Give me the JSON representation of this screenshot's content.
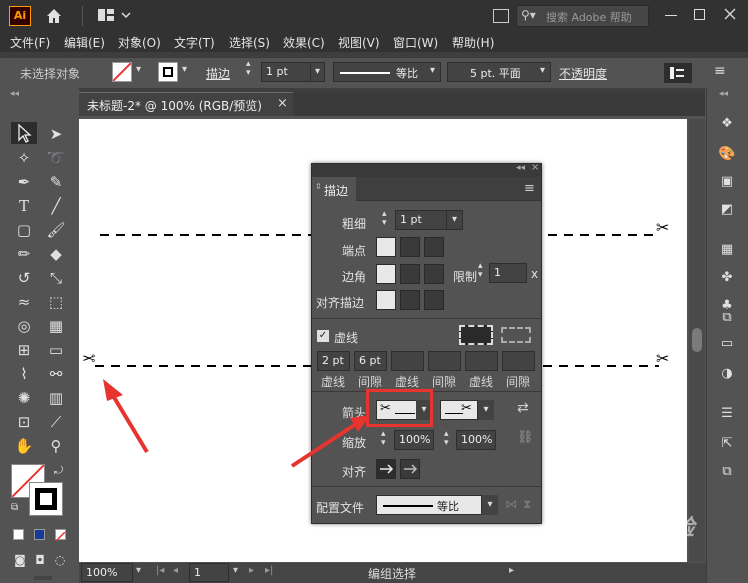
{
  "app": {
    "logo": "Ai",
    "search_placeholder": "搜索 Adobe 帮助"
  },
  "menu": [
    "文件(F)",
    "编辑(E)",
    "对象(O)",
    "文字(T)",
    "选择(S)",
    "效果(C)",
    "视图(V)",
    "窗口(W)",
    "帮助(H)"
  ],
  "options_bar": {
    "selection": "未选择对象",
    "stroke_label": "描边",
    "stroke_weight": "1 pt",
    "profile": "等比",
    "brush": "5 pt. 平面",
    "opacity": "不透明度"
  },
  "document": {
    "tab_title": "未标题-2* @ 100% (RGB/预览)",
    "zoom": "100%",
    "page": "1",
    "status": "编组选择"
  },
  "stroke_panel": {
    "title": "描边",
    "weight_label": "粗细",
    "weight_value": "1 pt",
    "cap_label": "端点",
    "corner_label": "边角",
    "limit_label": "限制",
    "limit_value": "1",
    "limit_unit": "x",
    "align_label": "对齐描边",
    "dashed_label": "虚线",
    "dash_values": [
      "2 pt",
      "6 pt",
      "",
      "",
      "",
      ""
    ],
    "dash_labels": [
      "虚线",
      "间隙",
      "虚线",
      "间隙",
      "虚线",
      "间隙"
    ],
    "arrow_label": "箭头",
    "scale_label": "缩放",
    "scale_start": "100%",
    "scale_end": "100%",
    "align_arrow_label": "对齐",
    "profile_label": "配置文件",
    "profile_value": "等比"
  },
  "colors": {
    "highlight": "#e8342f",
    "panel_bg": "#535353",
    "ui_dark": "#323232"
  },
  "watermark": "Baidu 经验"
}
